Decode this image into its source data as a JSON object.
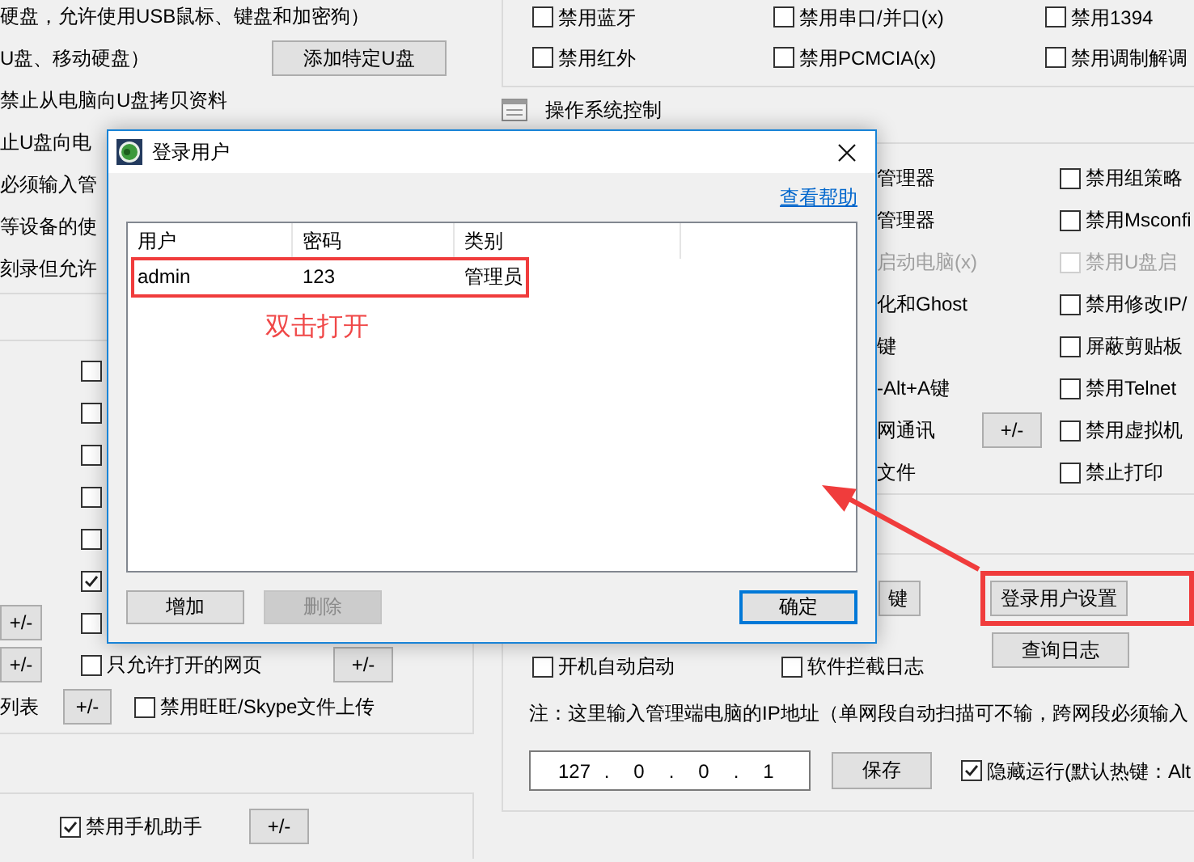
{
  "left_panel": {
    "usb_rows": [
      {
        "text": "硬盘，允许使用USB鼠标、键盘和加密狗）"
      },
      {
        "text": "U盘、移动硬盘）",
        "button": "添加特定U盘"
      },
      {
        "text": "禁止从电脑向U盘拷贝资料"
      },
      {
        "text": "止U盘向电"
      },
      {
        "text": "必须输入管"
      },
      {
        "text": "等设备的使"
      },
      {
        "text": "刻录但允许"
      }
    ],
    "web_rows": [
      {
        "checked": false
      },
      {
        "checked": false
      },
      {
        "checked": false
      },
      {
        "checked": false
      },
      {
        "checked": false
      },
      {
        "checked": true
      },
      {
        "left_button": "+/-",
        "checked": false
      },
      {
        "left_button": "+/-",
        "checked": false,
        "label": "只允许打开的网页",
        "button": "+/-"
      }
    ],
    "list_row": {
      "text": "列表",
      "button": "+/-",
      "checked": false,
      "label": "禁用旺旺/Skype文件上传"
    },
    "mobile_row": {
      "checked": true,
      "label": "禁用手机助手",
      "button": "+/-"
    }
  },
  "right_panel": {
    "devices": [
      {
        "label": "禁用蓝牙",
        "checked": false
      },
      {
        "label": "禁用串口/并口(x)",
        "checked": false
      },
      {
        "label": "禁用1394",
        "checked": false
      },
      {
        "label": "禁用红外",
        "checked": false
      },
      {
        "label": "禁用PCMCIA(x)",
        "checked": false
      },
      {
        "label": "禁用调制解调",
        "checked": false
      }
    ],
    "os_control": {
      "title": "操作系统控制",
      "rows": [
        {
          "text": "管理器",
          "disabled": false,
          "option": {
            "label": "禁用组策略",
            "checked": false,
            "disabled": false
          }
        },
        {
          "text": "管理器",
          "disabled": false,
          "option": {
            "label": "禁用Msconfi",
            "checked": false,
            "disabled": false
          }
        },
        {
          "text": "启动电脑(x)",
          "disabled": true,
          "option": {
            "label": "禁用U盘启",
            "checked": false,
            "disabled": true
          }
        },
        {
          "text": "化和Ghost",
          "disabled": false,
          "option": {
            "label": "禁用修改IP/",
            "checked": false,
            "disabled": false
          }
        },
        {
          "text": "键",
          "disabled": false,
          "option": {
            "label": "屏蔽剪贴板",
            "checked": false,
            "disabled": false
          }
        },
        {
          "text": "-Alt+A键",
          "disabled": false,
          "option": {
            "label": "禁用Telnet",
            "checked": false,
            "disabled": false
          }
        },
        {
          "text": "网通讯",
          "disabled": false,
          "button": "+/-",
          "option": {
            "label": "禁用虚拟机",
            "checked": false,
            "disabled": false
          }
        },
        {
          "text": "文件",
          "disabled": false,
          "option": {
            "label": "禁止打印",
            "checked": false,
            "disabled": false
          }
        }
      ]
    },
    "system": {
      "partial_button": "键",
      "user_settings_button": "登录用户设置",
      "options": [
        {
          "label": "开机自动启动",
          "checked": false
        },
        {
          "label": "软件拦截日志",
          "checked": false
        }
      ],
      "log_button": "查询日志",
      "note": "注：这里输入管理端电脑的IP地址（单网段自动扫描可不输，跨网段必须输入",
      "ip_field": {
        "octets": [
          "127",
          "0",
          "0",
          "1"
        ],
        "separator": "."
      },
      "save_button": "保存",
      "hide_run": {
        "label": "隐藏运行(默认热键：Alt",
        "checked": true
      }
    }
  },
  "dialog": {
    "title": "登录用户",
    "help_link": "查看帮助",
    "columns": [
      "用户",
      "密码",
      "类别"
    ],
    "rows": [
      {
        "cells": [
          "admin",
          "123",
          "管理员"
        ]
      }
    ],
    "buttons": [
      {
        "label": "增加",
        "disabled": false,
        "default": false
      },
      {
        "label": "删除",
        "disabled": true,
        "default": false
      },
      {
        "label": "确定",
        "disabled": false,
        "default": true
      }
    ]
  },
  "annotation": {
    "text": "双击打开"
  }
}
